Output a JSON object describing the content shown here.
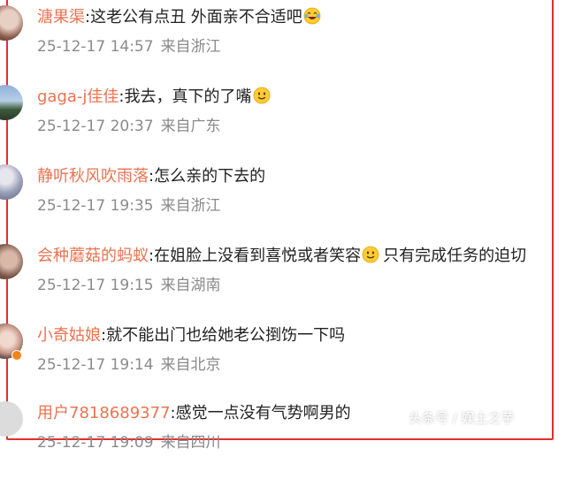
{
  "comments": [
    {
      "user": "溏果渠",
      "sep": ":",
      "text": "这老公有点丑 外面亲不合适吧",
      "emoji": "laughing-tears",
      "date": "25-12-17 14:57",
      "location": "来自浙江"
    },
    {
      "user": "gaga-j佳佳",
      "sep": ":",
      "text": "我去，真下的了嘴",
      "emoji": "smile",
      "date": "25-12-17 20:37",
      "location": "来自广东"
    },
    {
      "user": "静听秋风吹雨落",
      "sep": ":",
      "text": "怎么亲的下去的",
      "emoji": "",
      "date": "25-12-17 19:35",
      "location": "来自浙江"
    },
    {
      "user": "会种蘑菇的蚂蚁",
      "sep": ":",
      "text": "在姐脸上没看到喜悦或者笑容",
      "emoji": "smile",
      "text2": "只有完成任务的迫切",
      "date": "25-12-17 19:15",
      "location": "来自湖南"
    },
    {
      "user": "小奇姑娘",
      "sep": ":",
      "text": "就不能出门也给她老公捯饬一下吗",
      "emoji": "",
      "date": "25-12-17 19:14",
      "location": "来自北京"
    },
    {
      "user": "用户7818689377",
      "sep": ":",
      "text": "感觉一点没有气势啊男的",
      "emoji": "",
      "date": "25-12-17 19:09",
      "location": "来自四川"
    }
  ],
  "watermark": "头条号 / 娱土之芋"
}
